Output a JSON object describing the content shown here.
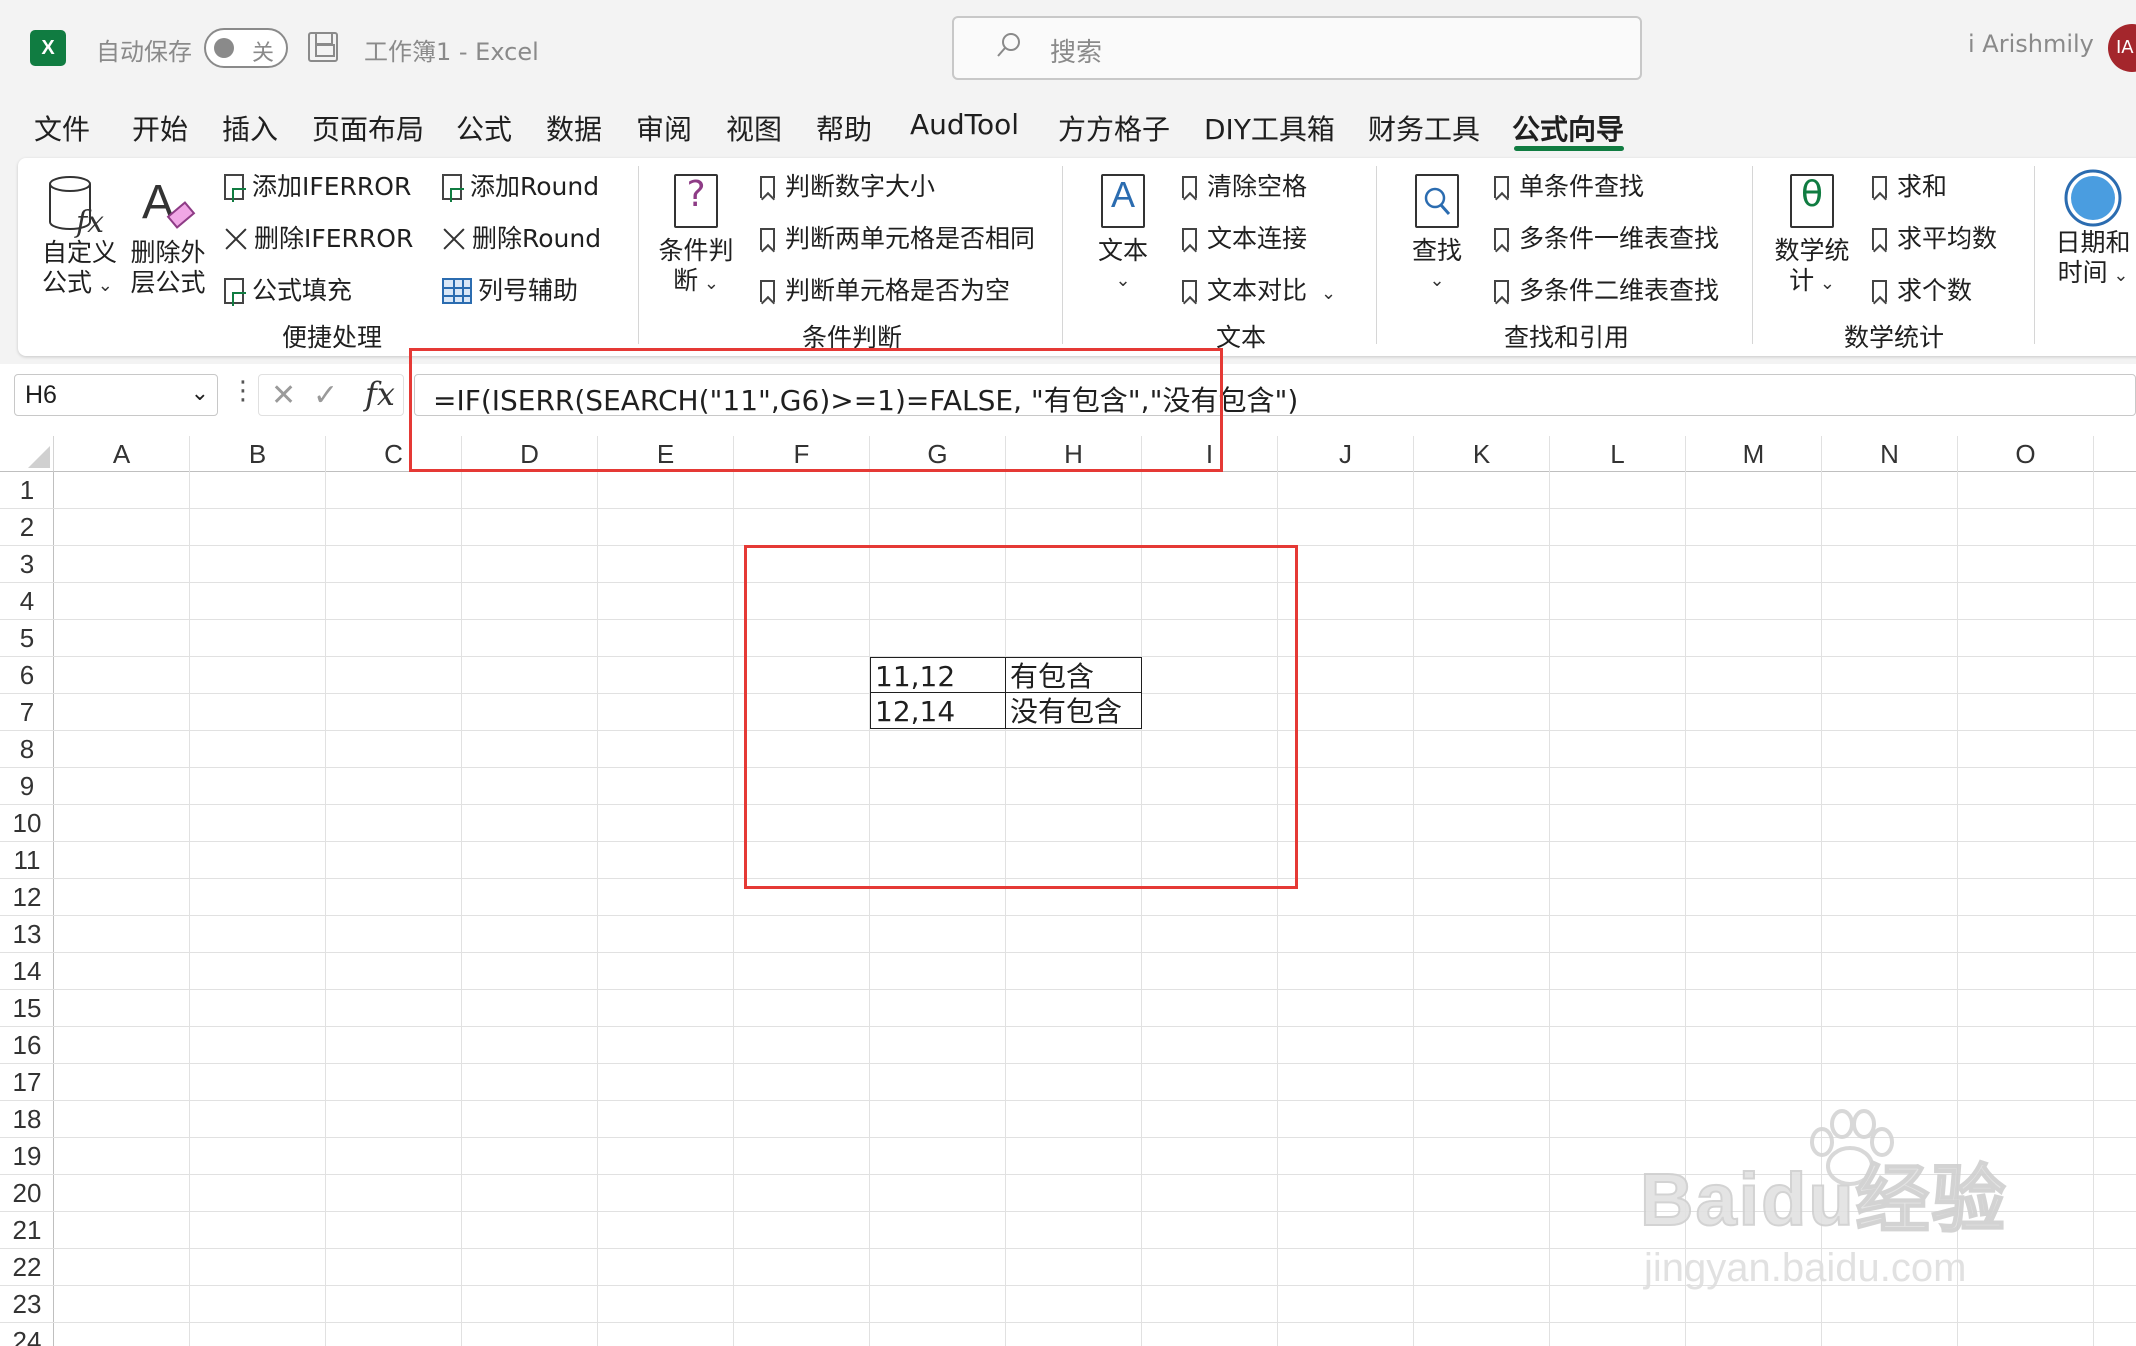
{
  "titlebar": {
    "autosave_label": "自动保存",
    "autosave_toggle": "关",
    "doc_title": "工作簿1  -  Excel",
    "search_placeholder": "搜索",
    "user_name": "i Arishmily",
    "user_initials": "IA"
  },
  "menu": {
    "tabs": [
      "文件",
      "开始",
      "插入",
      "页面布局",
      "公式",
      "数据",
      "审阅",
      "视图",
      "帮助",
      "AudTool",
      "方方格子",
      "DIY工具箱",
      "财务工具",
      "公式向导"
    ],
    "active_tab": "公式向导"
  },
  "ribbon": {
    "quick": {
      "custom_formula": [
        "自定义",
        "公式"
      ],
      "remove_outer": [
        "删除外",
        "层公式"
      ],
      "add_iferror": "添加IFERROR",
      "remove_iferror": "删除IFERROR",
      "formula_fill": "公式填充",
      "add_round": "添加Round",
      "remove_round": "删除Round",
      "col_helper": "列号辅助",
      "group_label": "便捷处理"
    },
    "condition": {
      "big_button": [
        "条件判",
        "断"
      ],
      "items": [
        "判断数字大小",
        "判断两单元格是否相同",
        "判断单元格是否为空"
      ],
      "group_label": "条件判断"
    },
    "text": {
      "big_button": "文本",
      "items": [
        "清除空格",
        "文本连接",
        "文本对比"
      ],
      "group_label": "文本"
    },
    "lookup": {
      "big_button": "查找",
      "items": [
        "单条件查找",
        "多条件一维表查找",
        "多条件二维表查找"
      ],
      "group_label": "查找和引用"
    },
    "math": {
      "big_button": [
        "数学统",
        "计"
      ],
      "items": [
        "求和",
        "求平均数",
        "求个数"
      ],
      "group_label": "数学统计"
    },
    "datetime": {
      "big_button": [
        "日期和",
        "时间"
      ]
    }
  },
  "formula_bar": {
    "name_box": "H6",
    "formula": "=IF(ISERR(SEARCH(\"11\",G6)>=1)=FALSE, \"有包含\",\"没有包含\")"
  },
  "grid": {
    "columns": [
      "A",
      "B",
      "C",
      "D",
      "E",
      "F",
      "G",
      "H",
      "I",
      "J",
      "K",
      "L",
      "M",
      "N",
      "O"
    ],
    "rows": [
      "1",
      "2",
      "3",
      "4",
      "5",
      "6",
      "7",
      "8",
      "9",
      "10",
      "11",
      "12",
      "13",
      "14",
      "15",
      "16",
      "17",
      "18",
      "19",
      "20",
      "21",
      "22",
      "23",
      "24"
    ],
    "cells": {
      "G6": "11,12",
      "H6": "有包含",
      "G7": "12,14",
      "H7": "没有包含"
    }
  },
  "watermark": {
    "brand": "Baidu经验",
    "url": "jingyan.baidu.com"
  },
  "colors": {
    "accent": "#107c41",
    "highlight": "#e53935"
  }
}
